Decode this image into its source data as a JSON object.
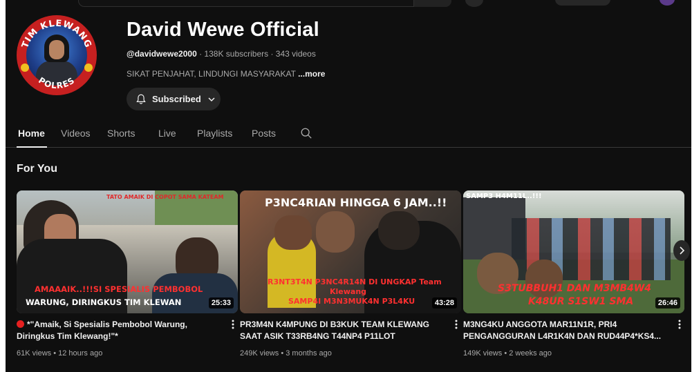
{
  "channel": {
    "name": "David Wewe Official",
    "handle": "@davidwewe2000",
    "meta_rest": " · 138K subscribers · 343 videos",
    "description": "SIKAT PENJAHAT, LINDUNGI MASYARAKAT ",
    "more_label": "...more",
    "avatar_ring_text": "TIM KLEWANG",
    "avatar_ring_text_bottom": "POLRES",
    "subscribe_label": "Subscribed"
  },
  "tabs": [
    {
      "label": "Home",
      "active": true
    },
    {
      "label": "Videos"
    },
    {
      "label": "Shorts"
    },
    {
      "label": "Live"
    },
    {
      "label": "Playlists"
    },
    {
      "label": "Posts"
    }
  ],
  "section": {
    "title": "For You"
  },
  "videos": [
    {
      "title": "*\"Amaik, Si Spesialis Pembobol Warung, Diringkus Tim Klewang!\"*",
      "views": "61K views",
      "age": "12 hours ago",
      "duration": "25:33",
      "overlay_top": "TATO AMAIK DI COPOT SAMA KATEAM",
      "overlay_red": "AMAAAIK..!!!SI SPESIALIS PEMBOBOL",
      "overlay_white": "WARUNG, DIRINGKUS TIM KLEWAN"
    },
    {
      "title": "PR3M4N K4MPUNG DI B3KUK TEAM KLEWANG SAAT ASIK T33RB4NG T44NP4 P11LOT",
      "views": "249K views",
      "age": "3 months ago",
      "duration": "43:28",
      "overlay_top": "P3NC4RIAN HINGGA 6 JAM..!!",
      "overlay_red_1": "R3NT3T4N P3NC4R14N DI UNGKAP Team",
      "overlay_red_2": "Klewang",
      "overlay_red_3": "SAMP4I M3N3MUK4N P3L4KU"
    },
    {
      "title": "M3NG4KU ANGGOTA MAR11N1R, PRI4 PENGANGGURAN L4R1K4N DAN RUD44P4*KS4...",
      "views": "149K views",
      "age": "2 weeks ago",
      "duration": "26:46",
      "overlay_top": "SAMP3 H4M11L..!!!",
      "overlay_red_1": "S3TUBBUH1 DAN M3MB4W4",
      "overlay_red_2": "K48UR S1SW1 SMA"
    }
  ],
  "colors": {
    "background": "#0f0f0f",
    "text_primary": "#f1f1f1",
    "text_secondary": "#aaaaaa",
    "button_bg": "#272727",
    "live_red": "#e52020"
  }
}
